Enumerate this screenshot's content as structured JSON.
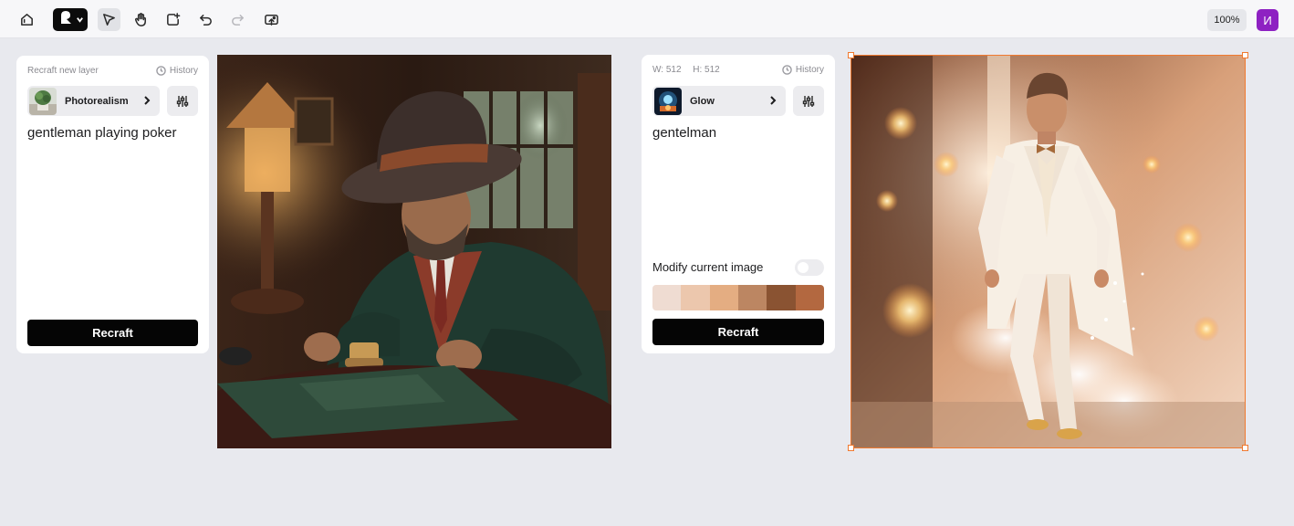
{
  "toolbar": {
    "icons": [
      "home-icon",
      "logo-icon",
      "chevron-down-icon",
      "select-cursor-icon",
      "hand-icon",
      "frame-add-icon",
      "undo-icon",
      "redo-icon",
      "export-icon"
    ],
    "zoom": "100%",
    "avatar_letter": "И",
    "avatar_color": "#8e21c2"
  },
  "panel_left": {
    "header": "Recraft new layer",
    "history_label": "History",
    "style_name": "Photorealism",
    "prompt": "gentleman playing poker",
    "button": "Recraft"
  },
  "panel_right": {
    "width_label": "W: 512",
    "height_label": "H: 512",
    "history_label": "History",
    "style_name": "Glow",
    "prompt": "gentelman",
    "modify_label": "Modify current image",
    "modify_enabled": false,
    "palette": [
      "#efdcd2",
      "#ecc7ad",
      "#e4ad82",
      "#bc8662",
      "#8a5332",
      "#b36840"
    ],
    "button": "Recraft"
  },
  "canvas": {
    "images": [
      "poker-gentleman-image",
      "glowing-gentleman-image"
    ],
    "selection_color": "#f07a30"
  }
}
